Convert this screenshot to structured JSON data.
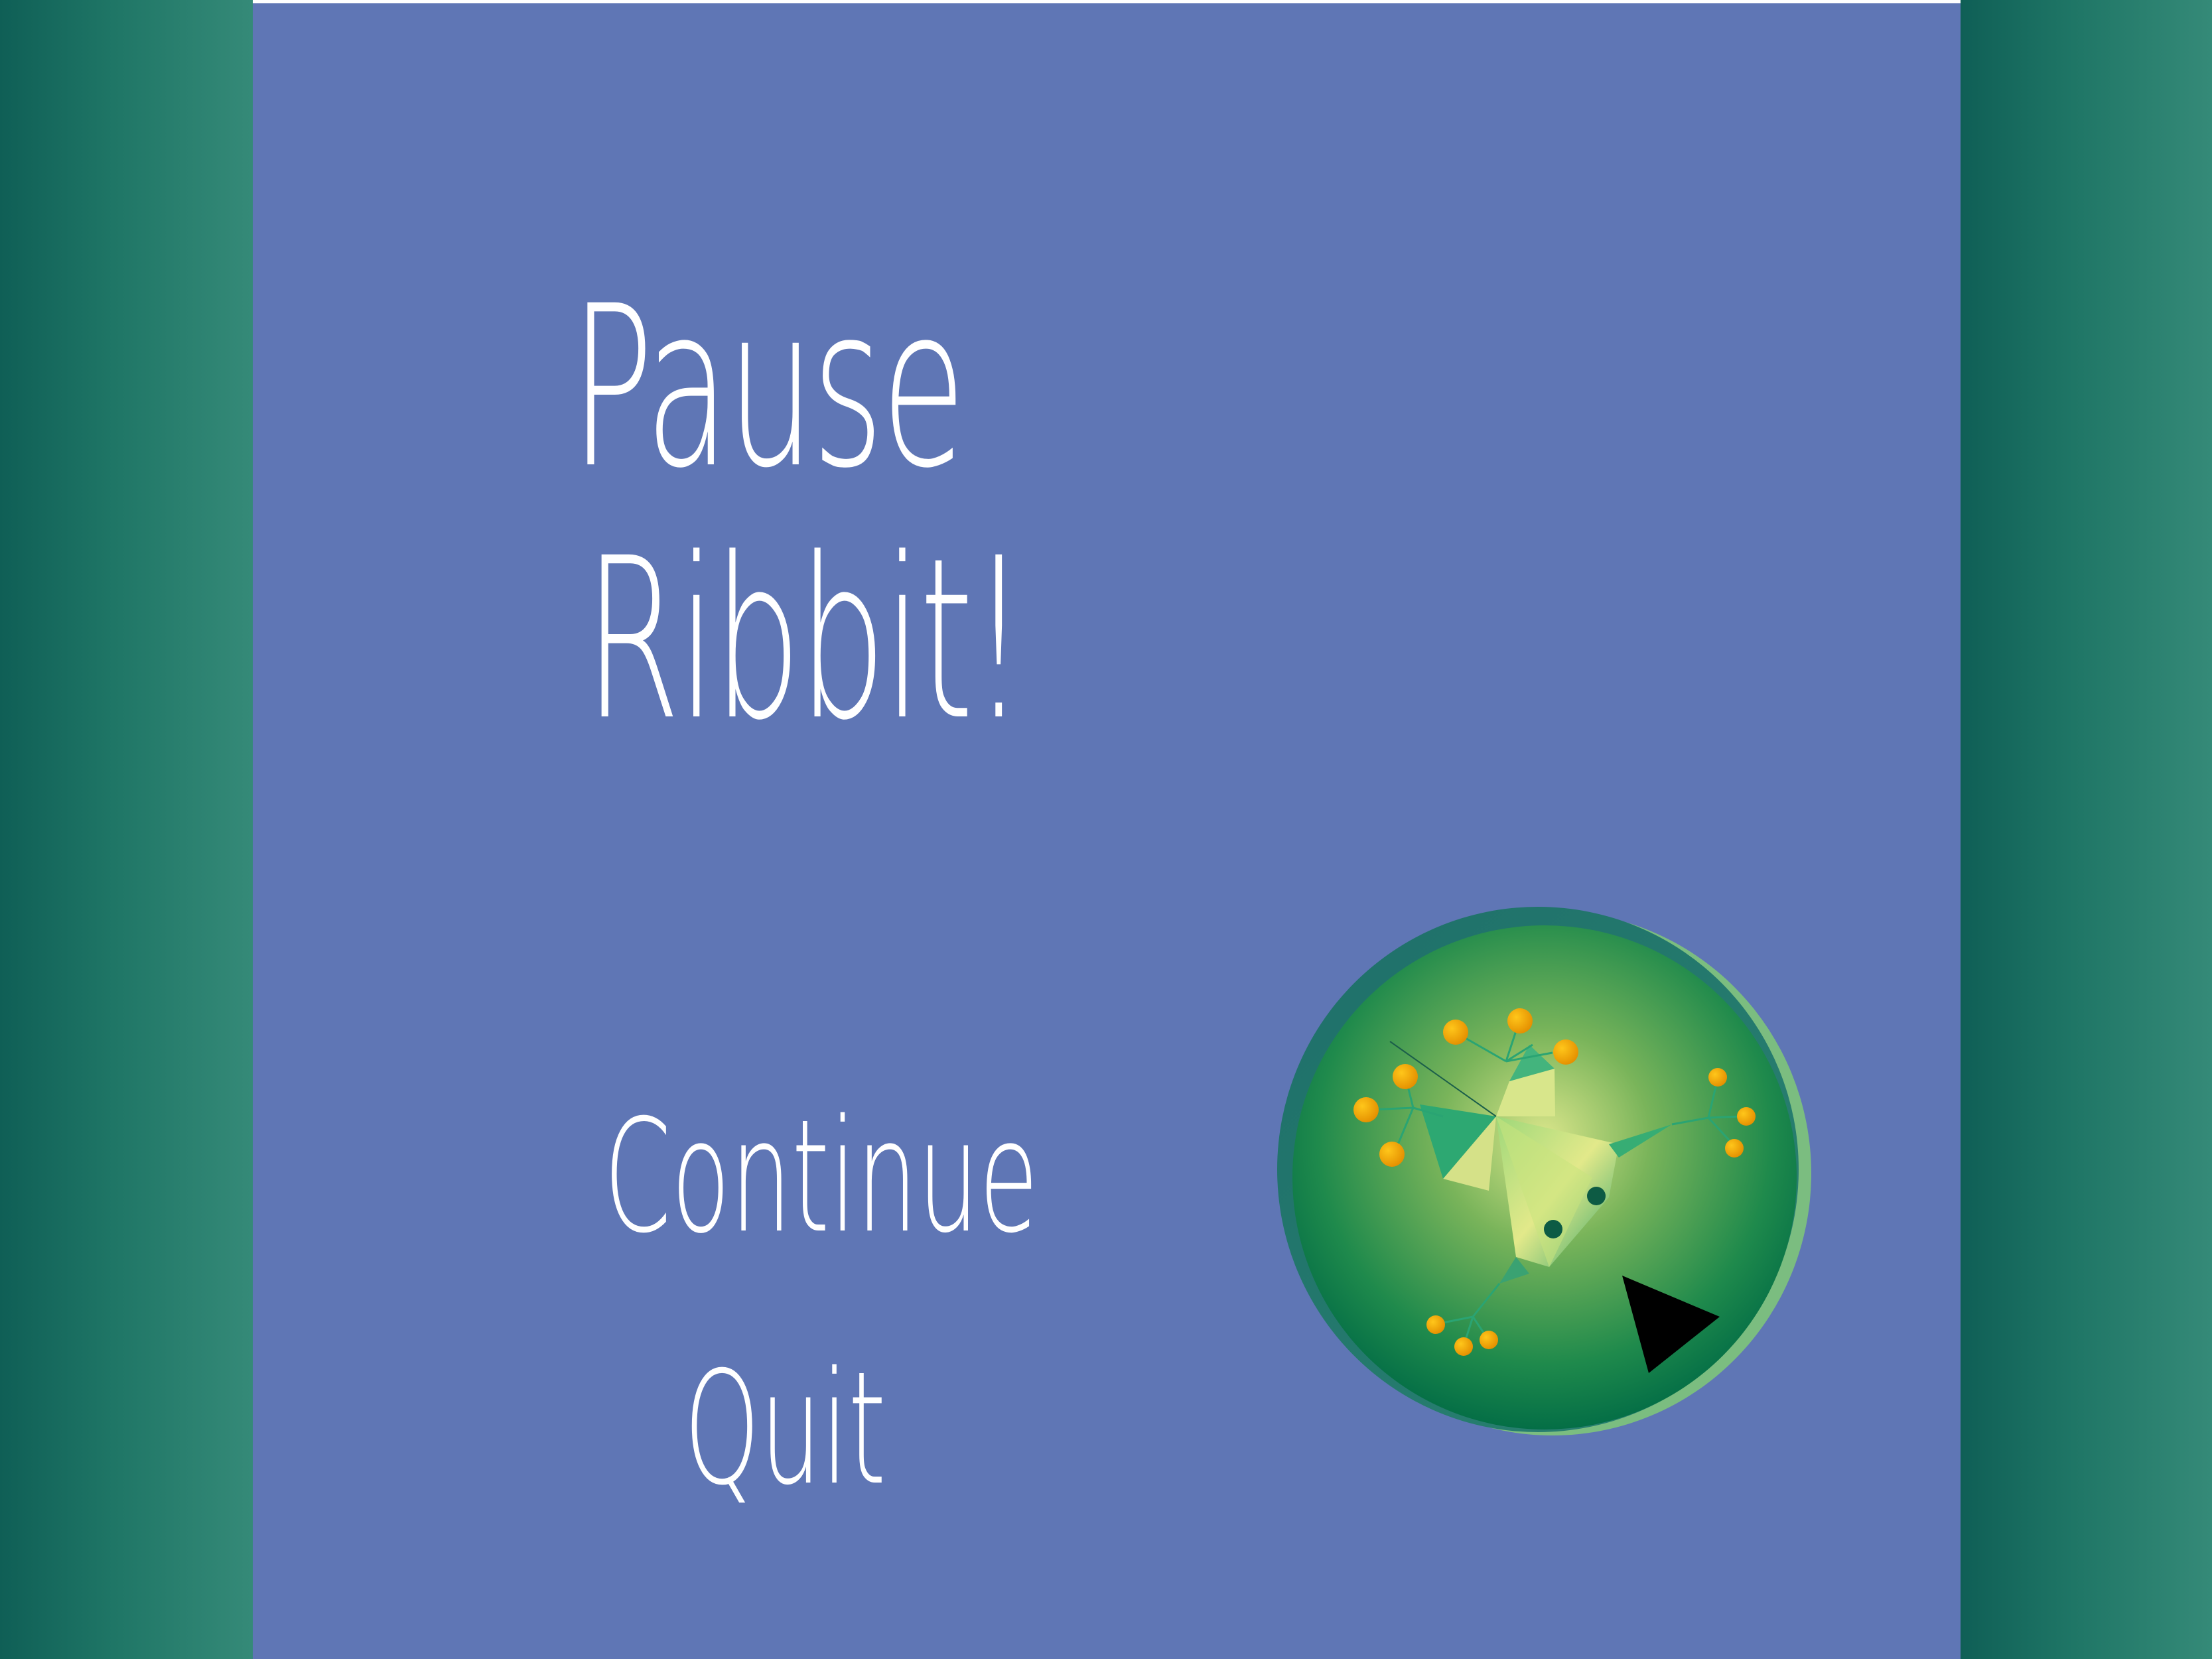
{
  "pause_screen": {
    "title_line1": "Pause",
    "title_line2": "Ribbit!",
    "menu": {
      "continue_label": "Continue",
      "quit_label": "Quit"
    }
  },
  "colors": {
    "background": "#5f76b5",
    "side_panel_dark": "#0f5f56",
    "side_panel_light": "#358a78",
    "text": "#ffffff",
    "orb_green": "#1f8a4c",
    "fly_yellow": "#f0a500"
  },
  "icons": {
    "orb": "frog-on-lilypad-orb-icon"
  }
}
